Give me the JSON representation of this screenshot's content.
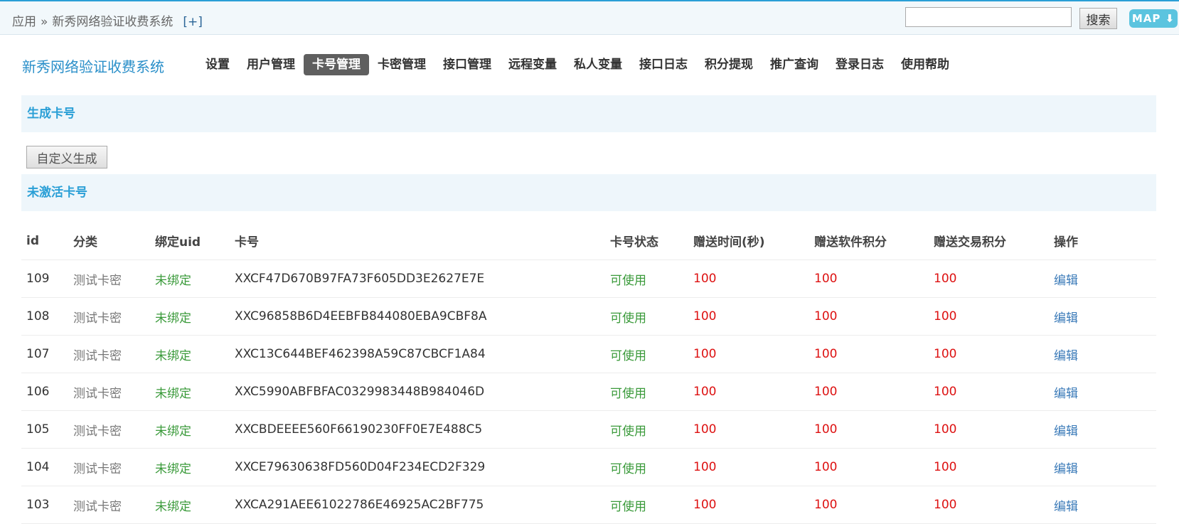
{
  "topbar": {
    "breadcrumb_root": "应用",
    "breadcrumb_sep": "»",
    "breadcrumb_current": "新秀网络验证收费系统",
    "add_label": "[+]",
    "search_value": "",
    "search_button": "搜索",
    "map_button": "MAP ⬇"
  },
  "brand": "新秀网络验证收费系统",
  "nav": [
    "设置",
    "用户管理",
    "卡号管理",
    "卡密管理",
    "接口管理",
    "远程变量",
    "私人变量",
    "接口日志",
    "积分提现",
    "推广查询",
    "登录日志",
    "使用帮助"
  ],
  "nav_active_index": 2,
  "generate": {
    "title": "生成卡号",
    "custom_button": "自定义生成"
  },
  "inactive": {
    "title": "未激活卡号",
    "columns": [
      "id",
      "分类",
      "绑定uid",
      "卡号",
      "卡号状态",
      "赠送时间(秒)",
      "赠送软件积分",
      "赠送交易积分",
      "操作"
    ],
    "rows": [
      {
        "id": "109",
        "cat": "测试卡密",
        "uid": "未绑定",
        "card": "XXCF47D670B97FA73F605DD3E2627E7E",
        "status": "可使用",
        "time": "100",
        "soft": "100",
        "trade": "100",
        "op": "编辑"
      },
      {
        "id": "108",
        "cat": "测试卡密",
        "uid": "未绑定",
        "card": "XXC96858B6D4EEBFB844080EBA9CBF8A",
        "status": "可使用",
        "time": "100",
        "soft": "100",
        "trade": "100",
        "op": "编辑"
      },
      {
        "id": "107",
        "cat": "测试卡密",
        "uid": "未绑定",
        "card": "XXC13C644BEF462398A59C87CBCF1A84",
        "status": "可使用",
        "time": "100",
        "soft": "100",
        "trade": "100",
        "op": "编辑"
      },
      {
        "id": "106",
        "cat": "测试卡密",
        "uid": "未绑定",
        "card": "XXC5990ABFBFAC0329983448B984046D",
        "status": "可使用",
        "time": "100",
        "soft": "100",
        "trade": "100",
        "op": "编辑"
      },
      {
        "id": "105",
        "cat": "测试卡密",
        "uid": "未绑定",
        "card": "XXCBDEEEE560F66190230FF0E7E488C5",
        "status": "可使用",
        "time": "100",
        "soft": "100",
        "trade": "100",
        "op": "编辑"
      },
      {
        "id": "104",
        "cat": "测试卡密",
        "uid": "未绑定",
        "card": "XXCE79630638FD560D04F234ECD2F329",
        "status": "可使用",
        "time": "100",
        "soft": "100",
        "trade": "100",
        "op": "编辑"
      },
      {
        "id": "103",
        "cat": "测试卡密",
        "uid": "未绑定",
        "card": "XXCA291AEE61022786E46925AC2BF775",
        "status": "可使用",
        "time": "100",
        "soft": "100",
        "trade": "100",
        "op": "编辑"
      }
    ]
  },
  "colors": {
    "accent": "#2a9fd6",
    "nav_active_bg": "#5f5f5f",
    "status_green": "#3a9a3a",
    "value_red": "#dd1111",
    "link_blue": "#3a7ab8"
  }
}
